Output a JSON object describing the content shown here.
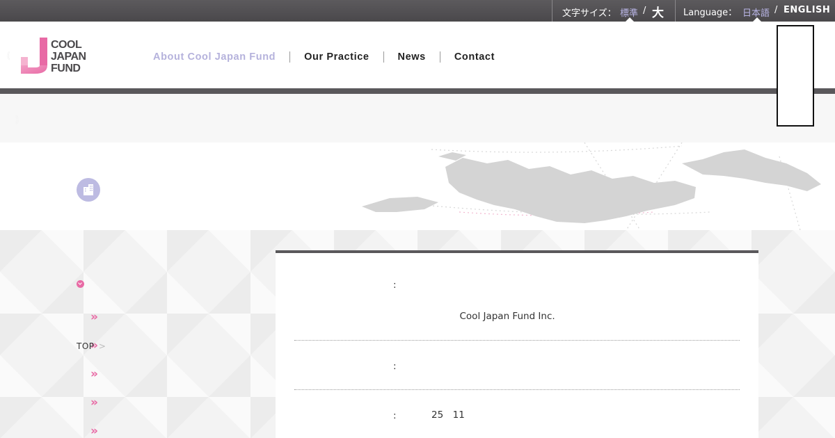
{
  "utility": {
    "site_name": "　　　　　",
    "font_size_label": "文字サイズ：",
    "font_size_standard": "標準",
    "separator": "/",
    "font_size_large": "大",
    "language_label": "Language：",
    "language_ja": "日本語",
    "language_en": "ENGLISH"
  },
  "header": {
    "skip_lines": [
      "　　　　",
      "(　　　",
      "　　　　　",
      "　　　　",
      "　)"
    ],
    "logo_lines": [
      "COOL",
      "JAPAN",
      "FUND"
    ],
    "nav": [
      "About Cool Japan Fund",
      "Our Practice",
      "News",
      "Contact"
    ]
  },
  "sidebar": {
    "title": "　　　　　　　　　　　　　",
    "items": [
      "　　　　　　　　　　",
      "　　　",
      "　　　　",
      "　　　　　　　　　　",
      "　　　　　　"
    ]
  },
  "breadcrumb": {
    "top": "TOP",
    "sep": ">"
  },
  "profile": {
    "colon": ":",
    "rows": [
      {
        "key": "　　",
        "lines": [
          "　　　　　　　　　",
          "　　　　　　　　　　　　　　　　　　　",
          "　　　　　Cool Japan Fund Inc."
        ]
      },
      {
        "key": "　　　",
        "lines": [
          "　　　　　　　　　　　　　"
        ]
      },
      {
        "key": "　　",
        "lines": [
          "　　25　11　"
        ]
      }
    ]
  },
  "colors": {
    "accent_lavender": "#b5b2dc",
    "accent_pink": "#e86aa5",
    "dark_bar": "#5a585b"
  }
}
